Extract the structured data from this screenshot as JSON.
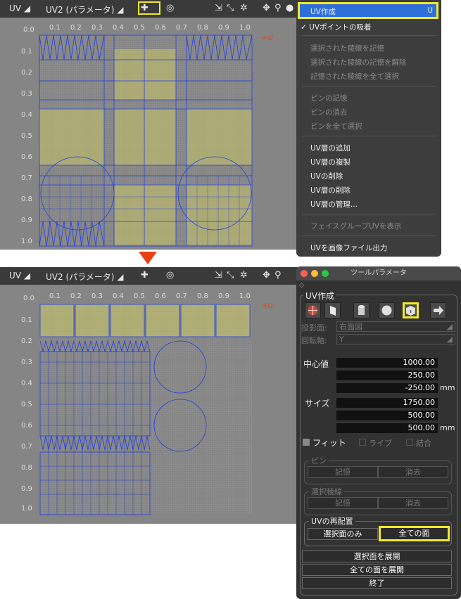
{
  "toolbar": {
    "uv_label": "UV",
    "uv2_label": "UV2 (パラメータ)"
  },
  "axis": {
    "cols": [
      "0.0",
      "0.1",
      "0.2",
      "0.3",
      "0.4",
      "0.5",
      "0.6",
      "0.7",
      "0.8",
      "0.9",
      "1.0"
    ],
    "rows": [
      "0.1",
      "0.2",
      "0.3",
      "0.4",
      "0.5",
      "0.6",
      "0.7",
      "0.8",
      "0.9",
      "1.0"
    ],
    "corner_mark": "+U"
  },
  "menu": {
    "items": [
      {
        "label": "UV作成",
        "shortcut": "U",
        "selected": true
      },
      {
        "label": "✓ UVポイントの吸着"
      },
      {
        "label": "選択された稜線を記憶",
        "disabled": true
      },
      {
        "label": "選択された稜線の記憶を解除",
        "disabled": true
      },
      {
        "label": "記憶された稜線を全て選択",
        "disabled": true
      },
      {
        "label": "ピンの記憶",
        "disabled": true
      },
      {
        "label": "ピンの消去",
        "disabled": true
      },
      {
        "label": "ピンを全て選択",
        "disabled": true
      },
      {
        "label": "UV層の追加"
      },
      {
        "label": "UV層の複製"
      },
      {
        "label": "UVの削除"
      },
      {
        "label": "UV層の削除"
      },
      {
        "label": "UV層の管理..."
      },
      {
        "label": "フェイスグループUVを表示",
        "disabled": true
      },
      {
        "label": "UVを画像ファイル出力"
      }
    ]
  },
  "panel": {
    "title": "ツールパラメータ",
    "section": "UV作成",
    "projection_label": "投影面:",
    "projection_value": "右面図",
    "rotation_label": "回転軸:",
    "rotation_value": "Y",
    "center_label": "中心値",
    "center_values": [
      "1000.00",
      "250.00",
      "-250.00"
    ],
    "size_label": "サイズ",
    "size_values": [
      "1750.00",
      "500.00",
      "500.00"
    ],
    "unit": "mm",
    "fit_label": "フィット",
    "live_label": "ライブ",
    "merge_label": "結合",
    "pin_group": "ピン",
    "remember": "記憶",
    "erase": "消去",
    "edge_group": "選択稜線",
    "relayout_group": "UVの再配置",
    "selected_faces_only": "選択面のみ",
    "all_faces": "全ての面",
    "expand_selected": "選択面を展開",
    "expand_all": "全ての面を展開",
    "finish": "終了"
  },
  "colors": {
    "highlight": "#f2ea2a",
    "uv_line": "#1f3fe0",
    "face_fill": "#c9c66a",
    "arrow": "#e8400f"
  }
}
